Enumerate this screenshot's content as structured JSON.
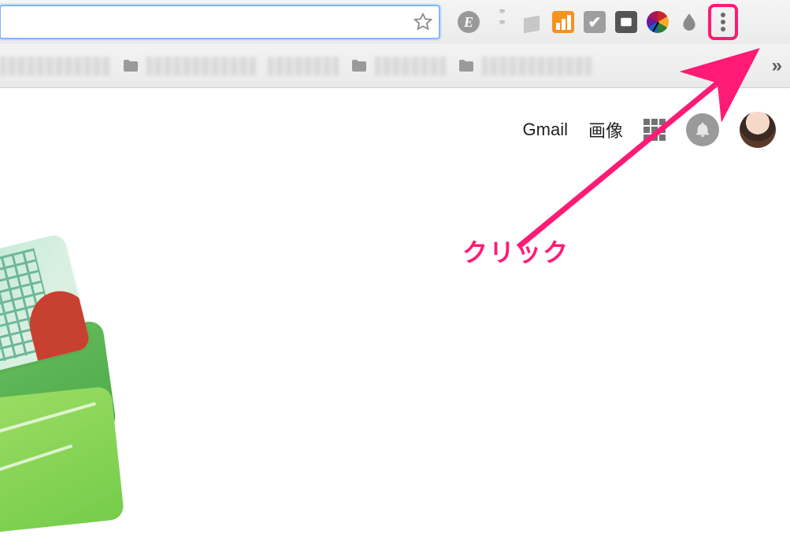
{
  "toolbar": {
    "address_value": "",
    "extensions": [
      {
        "name": "ext-evernote",
        "glyph": "E"
      },
      {
        "name": "ext-quotes"
      },
      {
        "name": "ext-buffer"
      },
      {
        "name": "ext-google-analytics"
      },
      {
        "name": "ext-checker",
        "glyph": "✔"
      },
      {
        "name": "ext-portfolio"
      },
      {
        "name": "ext-colorwheel"
      },
      {
        "name": "ext-droplet"
      }
    ]
  },
  "google_nav": {
    "gmail": "Gmail",
    "images": "画像"
  },
  "annotation": {
    "label": "クリック"
  }
}
